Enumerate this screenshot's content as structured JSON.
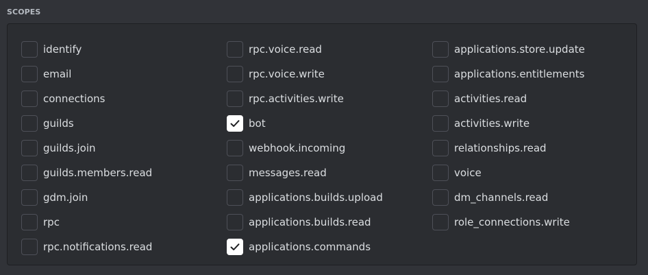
{
  "section_title": "SCOPES",
  "columns": [
    {
      "items": [
        {
          "label": "identify",
          "checked": false
        },
        {
          "label": "email",
          "checked": false
        },
        {
          "label": "connections",
          "checked": false
        },
        {
          "label": "guilds",
          "checked": false
        },
        {
          "label": "guilds.join",
          "checked": false
        },
        {
          "label": "guilds.members.read",
          "checked": false
        },
        {
          "label": "gdm.join",
          "checked": false
        },
        {
          "label": "rpc",
          "checked": false
        },
        {
          "label": "rpc.notifications.read",
          "checked": false
        }
      ]
    },
    {
      "items": [
        {
          "label": "rpc.voice.read",
          "checked": false
        },
        {
          "label": "rpc.voice.write",
          "checked": false
        },
        {
          "label": "rpc.activities.write",
          "checked": false
        },
        {
          "label": "bot",
          "checked": true
        },
        {
          "label": "webhook.incoming",
          "checked": false
        },
        {
          "label": "messages.read",
          "checked": false
        },
        {
          "label": "applications.builds.upload",
          "checked": false
        },
        {
          "label": "applications.builds.read",
          "checked": false
        },
        {
          "label": "applications.commands",
          "checked": true
        }
      ]
    },
    {
      "items": [
        {
          "label": "applications.store.update",
          "checked": false
        },
        {
          "label": "applications.entitlements",
          "checked": false
        },
        {
          "label": "activities.read",
          "checked": false
        },
        {
          "label": "activities.write",
          "checked": false
        },
        {
          "label": "relationships.read",
          "checked": false
        },
        {
          "label": "voice",
          "checked": false
        },
        {
          "label": "dm_channels.read",
          "checked": false
        },
        {
          "label": "role_connections.write",
          "checked": false
        }
      ]
    }
  ],
  "colors": {
    "background": "#313338",
    "panel": "#2b2d31",
    "checkbox_border": "#4e5058",
    "checkbox_checked": "#ffffff",
    "text": "#dbdee1",
    "section_title": "#b5bac1"
  },
  "icons": {
    "checkmark": "check-icon"
  }
}
